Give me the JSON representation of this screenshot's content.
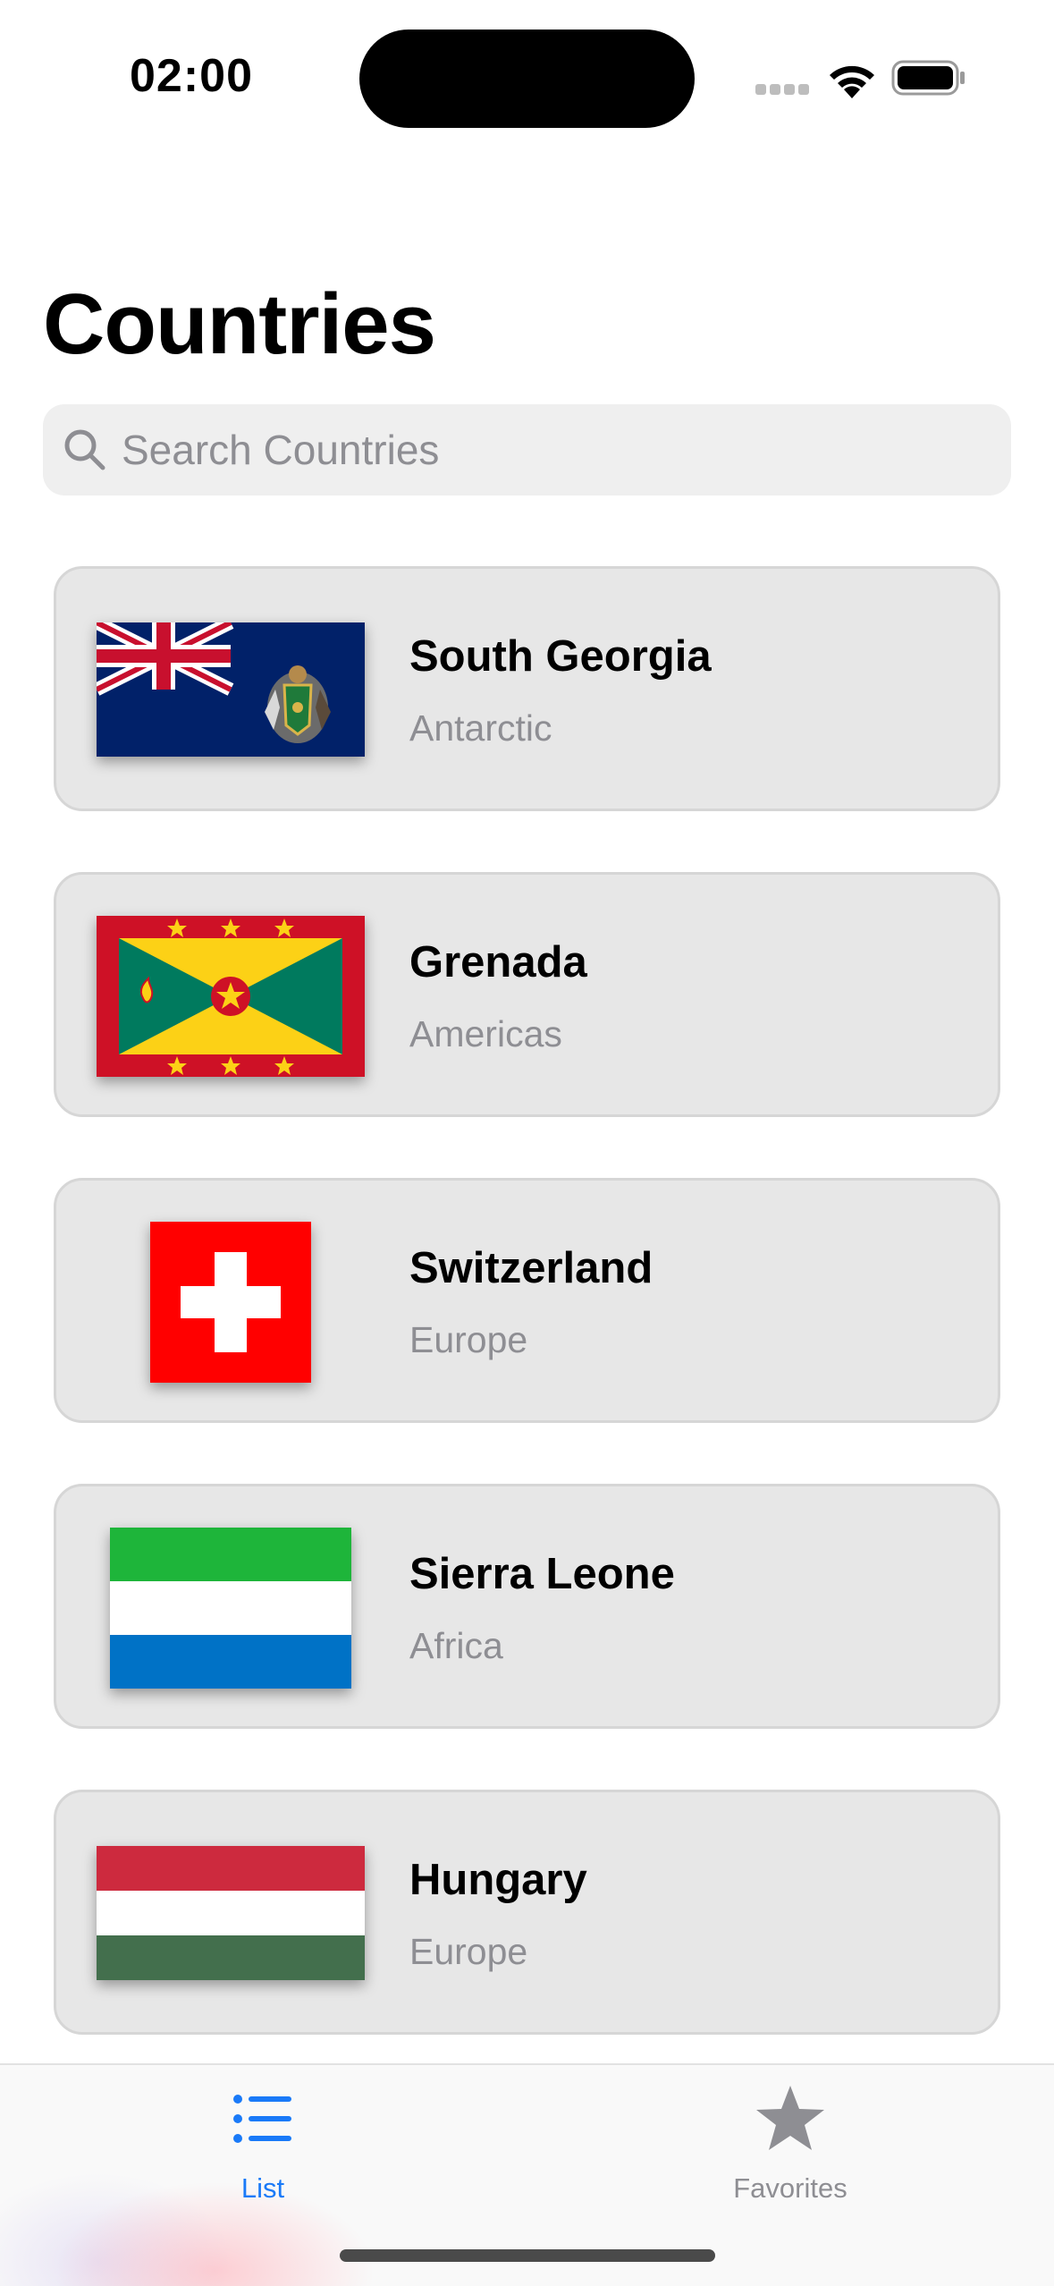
{
  "status_bar": {
    "time": "02:00"
  },
  "page": {
    "title": "Countries"
  },
  "search": {
    "placeholder": "Search Countries",
    "value": ""
  },
  "countries": [
    {
      "name": "South Georgia",
      "region": "Antarctic",
      "flag": "south-georgia-flag"
    },
    {
      "name": "Grenada",
      "region": "Americas",
      "flag": "grenada-flag"
    },
    {
      "name": "Switzerland",
      "region": "Europe",
      "flag": "switzerland-flag"
    },
    {
      "name": "Sierra Leone",
      "region": "Africa",
      "flag": "sierra-leone-flag"
    },
    {
      "name": "Hungary",
      "region": "Europe",
      "flag": "hungary-flag"
    }
  ],
  "tab_bar": {
    "tabs": [
      {
        "label": "List",
        "icon": "list-icon",
        "selected": true
      },
      {
        "label": "Favorites",
        "icon": "star-icon",
        "selected": false
      }
    ]
  },
  "colors": {
    "accent": "#1a7af8",
    "card_background": "#e7e7e7",
    "secondary_text": "#8e8e93"
  }
}
